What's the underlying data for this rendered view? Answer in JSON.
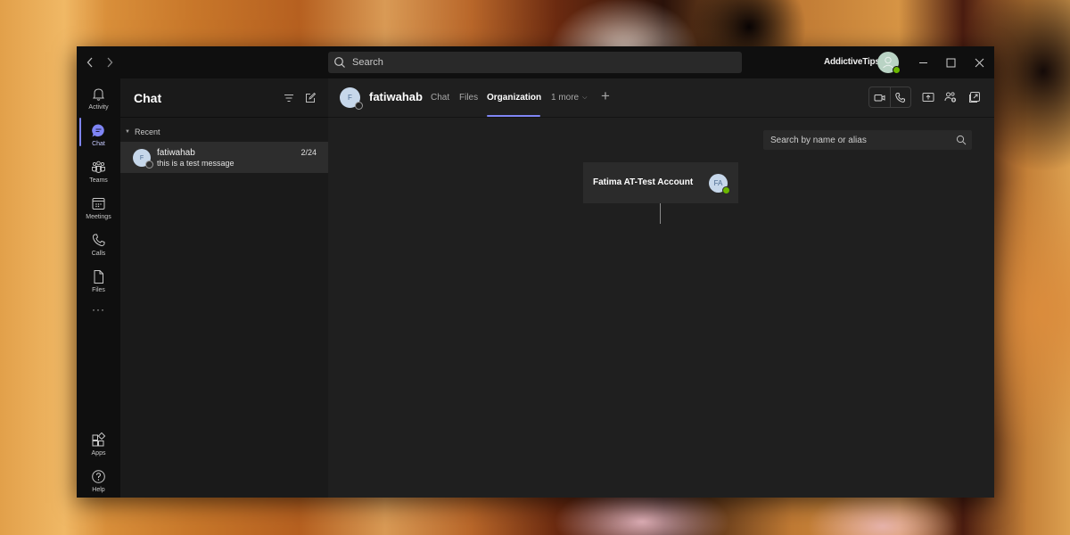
{
  "titlebar": {
    "search_placeholder": "Search",
    "user_name": "AddictiveTips",
    "icons": {
      "back": "chevron-left-icon",
      "forward": "chevron-right-icon",
      "minimize": "minimize-icon",
      "maximize": "maximize-icon",
      "close": "close-icon"
    }
  },
  "rail": {
    "items": [
      {
        "label": "Activity",
        "icon": "bell-icon"
      },
      {
        "label": "Chat",
        "icon": "chat-icon",
        "active": true
      },
      {
        "label": "Teams",
        "icon": "teams-icon"
      },
      {
        "label": "Meetings",
        "icon": "calendar-icon"
      },
      {
        "label": "Calls",
        "icon": "phone-icon"
      },
      {
        "label": "Files",
        "icon": "file-icon"
      },
      {
        "label": "Apps",
        "icon": "apps-icon"
      },
      {
        "label": "Help",
        "icon": "help-icon"
      }
    ],
    "more_label": "···"
  },
  "chat_panel": {
    "title": "Chat",
    "section_label": "Recent",
    "items": [
      {
        "initial": "F",
        "name": "fatiwahab",
        "preview": "this is a test message",
        "date": "2/24"
      }
    ]
  },
  "conversation": {
    "initial": "F",
    "name": "fatiwahab",
    "tabs": [
      {
        "label": "Chat"
      },
      {
        "label": "Files"
      },
      {
        "label": "Organization",
        "active": true
      },
      {
        "label": "1 more"
      }
    ],
    "add_tab_label": "+"
  },
  "organization": {
    "search_placeholder": "Search by name or alias",
    "card": {
      "name": "Fatima AT-Test Account",
      "initials": "FA",
      "presence": "available"
    }
  },
  "colors": {
    "accent": "#7f85f5",
    "presence_available": "#6bb700",
    "window_bg": "#1f1f1f",
    "rail_bg": "#0f0f0f"
  }
}
